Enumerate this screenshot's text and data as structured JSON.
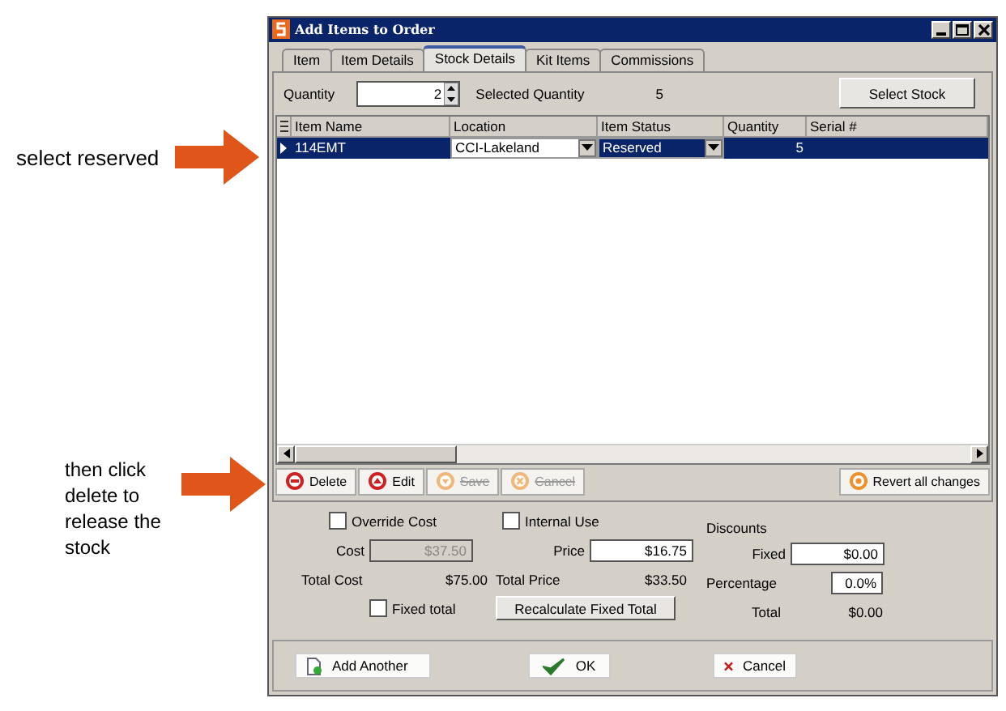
{
  "annotations": [
    {
      "text": "select reserved"
    },
    {
      "text": "then click delete to release the stock"
    }
  ],
  "window": {
    "title": "Add Items to Order"
  },
  "tabs": [
    {
      "label": "Item",
      "selected": false
    },
    {
      "label": "Item Details",
      "selected": false
    },
    {
      "label": "Stock Details",
      "selected": true
    },
    {
      "label": "Kit Items",
      "selected": false
    },
    {
      "label": "Commissions",
      "selected": false
    }
  ],
  "quantity": {
    "label": "Quantity",
    "value": "2"
  },
  "selected_quantity": {
    "label": "Selected Quantity",
    "value": "5"
  },
  "select_stock_button": "Select Stock",
  "table": {
    "columns": [
      "Item Name",
      "Location",
      "Item Status",
      "Quantity",
      "Serial #"
    ],
    "rows": [
      {
        "selected": true,
        "item_name": "114EMT",
        "location": "CCI-Lakeland",
        "status": "Reserved",
        "quantity": "5",
        "serial": ""
      }
    ]
  },
  "toolbar": [
    {
      "label": "Delete",
      "kind": "delete",
      "disabled": false
    },
    {
      "label": "Edit",
      "kind": "edit",
      "disabled": false
    },
    {
      "label": "Save",
      "kind": "save",
      "disabled": true
    },
    {
      "label": "Cancel",
      "kind": "cancel",
      "disabled": true
    }
  ],
  "revert_button": "Revert  all changes",
  "form": {
    "override_cost": {
      "label": "Override Cost",
      "checked": false
    },
    "internal_use": {
      "label": "Internal Use",
      "checked": false
    },
    "cost": {
      "label": "Cost",
      "value": "$37.50",
      "disabled": true
    },
    "price": {
      "label": "Price",
      "value": "$16.75",
      "disabled": false
    },
    "total_cost": {
      "label": "Total Cost",
      "value": "$75.00"
    },
    "total_price": {
      "label": "Total Price",
      "value": "$33.50"
    },
    "fixed_total": {
      "label": "Fixed total",
      "checked": false
    },
    "recalculate_button": "Recalculate Fixed Total",
    "discounts": {
      "heading": "Discounts",
      "fixed": {
        "label": "Fixed",
        "value": "$0.00"
      },
      "percentage": {
        "label": "Percentage",
        "value": "0.0%"
      },
      "total": {
        "label": "Total",
        "value": "$0.00"
      }
    }
  },
  "footer": [
    {
      "label": "Add Another",
      "kind": "add"
    },
    {
      "label": "OK",
      "kind": "ok"
    },
    {
      "label": "Cancel",
      "kind": "cancel"
    }
  ]
}
